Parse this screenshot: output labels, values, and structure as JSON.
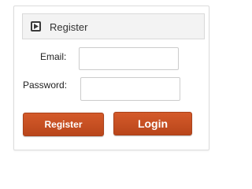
{
  "panel": {
    "title": "Register",
    "header_icon": "play-square-icon"
  },
  "form": {
    "email_label": "Email:",
    "email_value": "",
    "password_label": "Password:",
    "password_value": ""
  },
  "buttons": {
    "register_label": "Register",
    "login_label": "Login"
  },
  "colors": {
    "button_accent": "#c9501f",
    "header_background": "#f3f3f3",
    "border": "#dcdcdc"
  }
}
